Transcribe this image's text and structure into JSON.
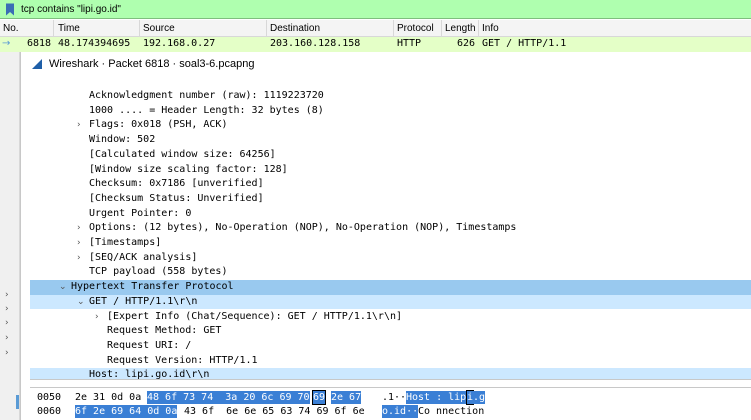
{
  "filter": {
    "icon": "bookmark-filter-icon",
    "text": "tcp contains \"lipi.go.id\""
  },
  "packet_list": {
    "headers": [
      "No.",
      "Time",
      "Source",
      "Destination",
      "Protocol",
      "Length",
      "Info"
    ],
    "row": {
      "no": "6818",
      "time": "48.174394695",
      "source": "192.168.0.27",
      "destination": "203.160.128.158",
      "protocol": "HTTP",
      "length": "626",
      "info": "GET / HTTP/1.1"
    }
  },
  "dialog": {
    "title": "Wireshark · Packet 6818 · soal3-6.pcapng",
    "icon": "wireshark-fin-icon"
  },
  "tree": [
    {
      "text": "Acknowledgment number (raw): 1119223720",
      "expander": ""
    },
    {
      "text": "1000 .... = Header Length: 32 bytes (8)",
      "expander": ""
    },
    {
      "text": "Flags: 0x018 (PSH, ACK)",
      "expander": "›"
    },
    {
      "text": "Window: 502",
      "expander": ""
    },
    {
      "text": "[Calculated window size: 64256]",
      "expander": ""
    },
    {
      "text": "[Window size scaling factor: 128]",
      "expander": ""
    },
    {
      "text": "Checksum: 0x7186 [unverified]",
      "expander": ""
    },
    {
      "text": "[Checksum Status: Unverified]",
      "expander": ""
    },
    {
      "text": "Urgent Pointer: 0",
      "expander": ""
    },
    {
      "text": "Options: (12 bytes), No-Operation (NOP), No-Operation (NOP), Timestamps",
      "expander": "›"
    },
    {
      "text": "[Timestamps]",
      "expander": "›"
    },
    {
      "text": "[SEQ/ACK analysis]",
      "expander": "›"
    },
    {
      "text": "TCP payload (558 bytes)",
      "expander": ""
    },
    {
      "text": "Hypertext Transfer Protocol",
      "expander": "⌄"
    },
    {
      "text": "GET / HTTP/1.1\\r\\n",
      "expander": "⌄"
    },
    {
      "text": "[Expert Info (Chat/Sequence): GET / HTTP/1.1\\r\\n]",
      "expander": "›"
    },
    {
      "text": "Request Method: GET",
      "expander": ""
    },
    {
      "text": "Request URI: /",
      "expander": ""
    },
    {
      "text": "Request Version: HTTP/1.1",
      "expander": ""
    },
    {
      "text": "Host: lipi.go.id\\r\\n",
      "expander": ""
    }
  ],
  "hex": [
    {
      "offset": "0050",
      "bytes_plain": "2e 31 0d 0a",
      "bytes_hl": "48 6f 73 74  3a 20 6c 69 70",
      "bytes_box": "69",
      "bytes_hl2": "2e 67",
      "ascii_plain": ".1··",
      "ascii_hl": "Host : lip",
      "ascii_box": "i",
      "ascii_hl2": ".g"
    },
    {
      "offset": "0060",
      "bytes_hl": "6f 2e 69 64 0d 0a",
      "bytes_plain": "43 6f  6e 6e 65 63 74 69 6f 6e",
      "ascii_hl": "o.id··",
      "ascii_plain": "Co nnection"
    }
  ]
}
